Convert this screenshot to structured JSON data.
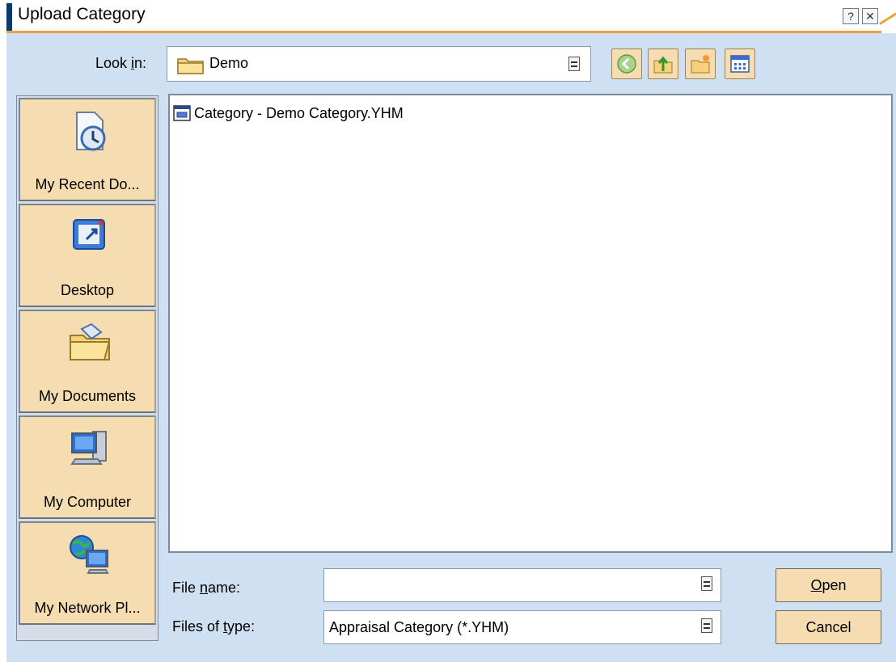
{
  "window": {
    "title": "Upload Category",
    "help_button": "?",
    "close_button": "✕"
  },
  "lookin": {
    "label": "Look in:",
    "value": "Demo"
  },
  "toolbar": {
    "back_icon": "back-arrow-icon",
    "up_icon": "up-folder-icon",
    "new_folder_icon": "new-folder-icon",
    "view_menu_icon": "view-menu-icon"
  },
  "places": [
    {
      "label": "My Recent Do...",
      "icon": "recent-documents-icon"
    },
    {
      "label": "Desktop",
      "icon": "desktop-icon"
    },
    {
      "label": "My Documents",
      "icon": "my-documents-icon"
    },
    {
      "label": "My Computer",
      "icon": "my-computer-icon"
    },
    {
      "label": "My Network Pl...",
      "icon": "my-network-places-icon"
    }
  ],
  "files": [
    {
      "name": "Category - Demo Category.YHM",
      "icon": "yhm-file-icon"
    }
  ],
  "filename": {
    "label": "File name:",
    "value": ""
  },
  "filetype": {
    "label": "Files of type:",
    "value": "Appraisal Category (*.YHM)"
  },
  "buttons": {
    "open": "Open",
    "cancel": "Cancel"
  },
  "colors": {
    "surface": "#cfe0f2",
    "button": "#f5ddb1",
    "accent_orange": "#e8a33c",
    "title_accent": "#0a3a6b"
  }
}
